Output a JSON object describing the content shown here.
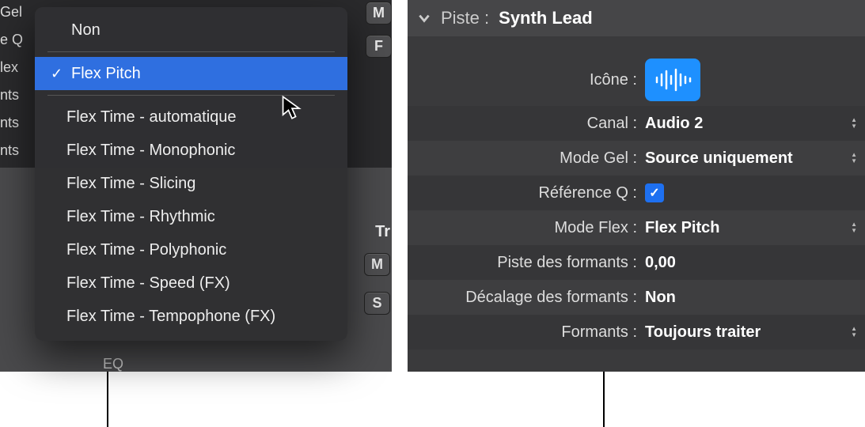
{
  "left": {
    "sidebar_fragments": [
      "Gel",
      "e Q",
      "lex",
      "nts",
      "nts",
      "nts"
    ],
    "top_buttons": [
      "M",
      "F"
    ],
    "section_label": "Tr",
    "lower_buttons": [
      "M",
      "S"
    ],
    "eq_label": "EQ"
  },
  "popup": {
    "none": "Non",
    "selected": "Flex Pitch",
    "items": [
      "Flex Time - automatique",
      "Flex Time - Monophonic",
      "Flex Time - Slicing",
      "Flex Time - Rhythmic",
      "Flex Time - Polyphonic",
      "Flex Time - Speed (FX)",
      "Flex Time - Tempophone (FX)"
    ]
  },
  "inspector": {
    "header_label": "Piste :",
    "track_name": "Synth Lead",
    "rows": {
      "icon_label": "Icône  :",
      "canal_label": "Canal :",
      "canal_value": "Audio 2",
      "gel_label": "Mode Gel  :",
      "gel_value": "Source uniquement",
      "refq_label": "Référence Q  :",
      "flex_label": "Mode Flex  :",
      "flex_value": "Flex Pitch",
      "formant_track_label": "Piste des formants  :",
      "formant_track_value": "0,00",
      "formant_shift_label": "Décalage des formants  :",
      "formant_shift_value": "Non",
      "formants_label": "Formants  :",
      "formants_value": "Toujours traiter"
    }
  }
}
